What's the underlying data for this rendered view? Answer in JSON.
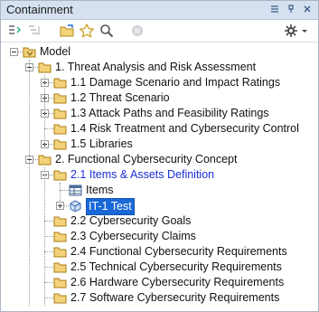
{
  "panel": {
    "title": "Containment",
    "pin_icon": "pin-icon",
    "close_icon": "close-icon"
  },
  "toolbar": {
    "icons": [
      "collapse-all-icon",
      "expand-all-icon",
      "open-folder-icon",
      "favorite-star-icon",
      "search-icon",
      "filter-icon",
      "settings-gear-icon"
    ]
  },
  "tree": {
    "rows": [
      {
        "label": "Model",
        "level": 0,
        "expander": "minus",
        "icon": "model-folder-icon",
        "style": "normal"
      },
      {
        "label": "1. Threat Analysis and Risk Assessment",
        "level": 1,
        "expander": "minus",
        "icon": "folder-icon",
        "style": "normal"
      },
      {
        "label": "1.1 Damage Scenario and Impact Ratings",
        "level": 2,
        "expander": "plus",
        "icon": "folder-icon",
        "style": "normal"
      },
      {
        "label": "1.2 Threat Scenario",
        "level": 2,
        "expander": "plus",
        "icon": "folder-icon",
        "style": "normal"
      },
      {
        "label": "1.3 Attack Paths and Feasibility Ratings",
        "level": 2,
        "expander": "plus",
        "icon": "folder-icon",
        "style": "normal"
      },
      {
        "label": "1.4 Risk Treatment and Cybersecurity Control",
        "level": 2,
        "expander": "none",
        "icon": "folder-icon",
        "style": "normal"
      },
      {
        "label": "1.5 Libraries",
        "level": 2,
        "expander": "plus",
        "icon": "folder-icon",
        "style": "normal"
      },
      {
        "label": "2. Functional Cybersecurity Concept",
        "level": 1,
        "expander": "minus",
        "icon": "folder-icon",
        "style": "normal"
      },
      {
        "label": "2.1 Items & Assets Definition",
        "level": 2,
        "expander": "minus",
        "icon": "folder-icon",
        "style": "link"
      },
      {
        "label": "Items",
        "level": 3,
        "expander": "none",
        "icon": "table-icon",
        "style": "normal"
      },
      {
        "label": "IT-1 Test",
        "level": 3,
        "expander": "plus",
        "icon": "item-block-icon",
        "style": "selected"
      },
      {
        "label": "2.2 Cybersecurity Goals",
        "level": 2,
        "expander": "none",
        "icon": "folder-icon",
        "style": "normal"
      },
      {
        "label": "2.3 Cybersecurity Claims",
        "level": 2,
        "expander": "none",
        "icon": "folder-icon",
        "style": "normal"
      },
      {
        "label": "2.4 Functional Cybersecurity Requirements",
        "level": 2,
        "expander": "none",
        "icon": "folder-icon",
        "style": "normal"
      },
      {
        "label": "2.5 Technical Cybersecurity Requirements",
        "level": 2,
        "expander": "none",
        "icon": "folder-icon",
        "style": "normal"
      },
      {
        "label": "2.6 Hardware Cybersecurity Requirements",
        "level": 2,
        "expander": "none",
        "icon": "folder-icon",
        "style": "normal"
      },
      {
        "label": "2.7 Software Cybersecurity Requirements",
        "level": 2,
        "expander": "none",
        "icon": "folder-icon",
        "style": "normal"
      }
    ]
  },
  "colors": {
    "titlebar_bg": "#d5e1f0",
    "selection": "#1a68d8",
    "link": "#1a2fd8",
    "folder": "#f3d27a"
  }
}
